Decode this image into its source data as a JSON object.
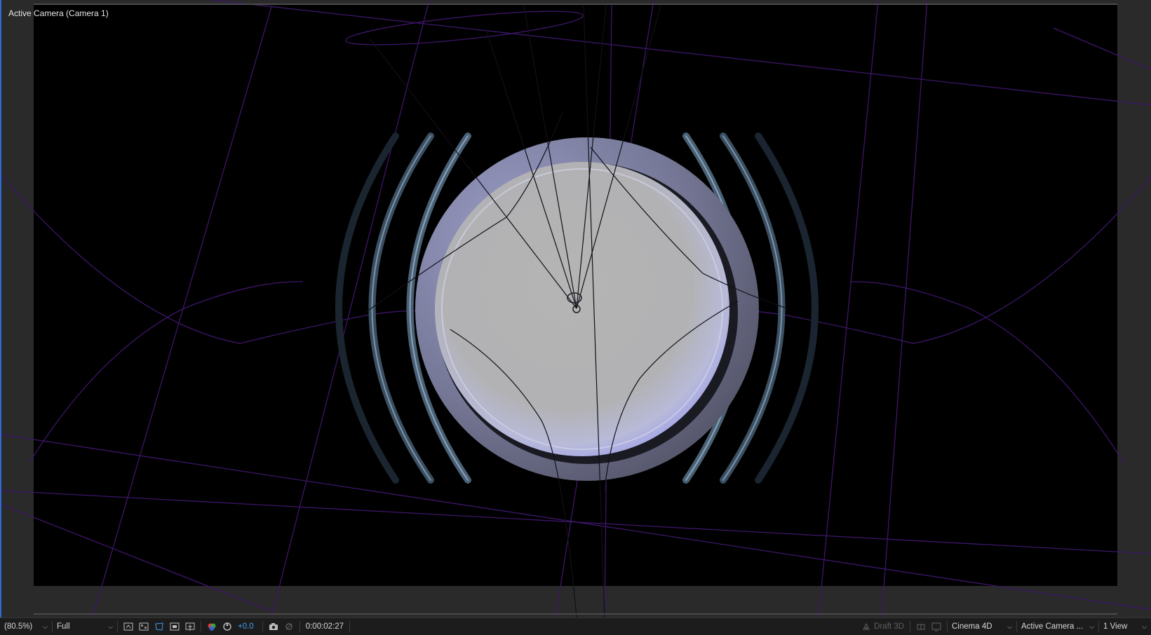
{
  "viewer": {
    "title": "Active Camera (Camera 1)"
  },
  "toolbar": {
    "magnification": "(80.5%)",
    "resolution": "Full",
    "exposure": "+0.0",
    "timecode": "0:00:02:27",
    "draft3d": "Draft 3D",
    "renderer": "Cinema 4D",
    "camera_view": "Active Camera ...",
    "view_layout": "1 View"
  },
  "icons": {
    "region_of_interest": "region-of-interest-icon",
    "transparency_grid": "transparency-grid-icon",
    "mask_visibility": "mask-visibility-icon",
    "guides": "guides-icon",
    "channels": "rgb-channels-icon",
    "reset_exposure": "reset-exposure-icon",
    "snapshot": "camera-snapshot-icon",
    "show_snapshot": "show-snapshot-icon",
    "draft3d": "draft-3d-icon",
    "ground_plane": "ground-plane-icon",
    "extended_viewer": "extended-viewer-icon"
  },
  "colors": {
    "accent": "#2d6bd0",
    "exposure": "#3e9cf2",
    "wireframe": "#3d1669"
  }
}
